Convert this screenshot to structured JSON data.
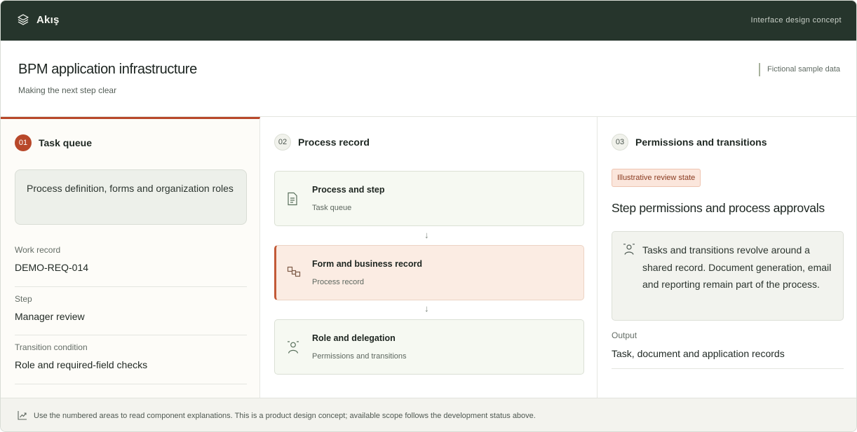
{
  "topbar": {
    "brand_icon": "layers-icon",
    "brand_name": "Akış",
    "tagline": "Interface design concept"
  },
  "header": {
    "title": "BPM application infrastructure",
    "subtitle": "Making the next step clear",
    "sample_note": "Fictional sample data"
  },
  "task_queue": {
    "number": "01",
    "title": "Task queue",
    "callout": "Process definition, forms and organization roles",
    "fields": [
      {
        "label": "Work record",
        "value": "DEMO-REQ-014"
      },
      {
        "label": "Step",
        "value": "Manager review"
      },
      {
        "label": "Transition condition",
        "value": "Role and required-field checks"
      }
    ]
  },
  "process_record": {
    "number": "02",
    "title": "Process record",
    "cards": [
      {
        "title": "Process and step",
        "subtitle": "Task queue",
        "icon": "document-icon"
      },
      {
        "title": "Form and business record",
        "subtitle": "Process record",
        "icon": "blocks-icon"
      },
      {
        "title": "Role and delegation",
        "subtitle": "Permissions and transitions",
        "icon": "user-icon"
      }
    ],
    "arrow_glyph": "↓"
  },
  "permissions": {
    "number": "03",
    "title": "Permissions and transitions",
    "badge": "Illustrative review state",
    "heading": "Step permissions and process approvals",
    "note": "Tasks and transitions revolve around a shared record. Document generation, email and reporting remain part of the process.",
    "output_label": "Output",
    "output_value": "Task, document and application records"
  },
  "footer": {
    "icon": "trend-chart-icon",
    "text": "Use the numbered areas to read component explanations. This is a product design concept; available scope follows the development status above."
  },
  "colors": {
    "topbar": "#26352c",
    "accent": "#b8482a",
    "card_bg": "#f6f9f2",
    "highlight_bg": "#fbece3"
  }
}
